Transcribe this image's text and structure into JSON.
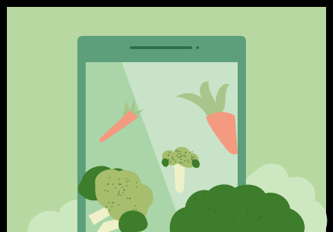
{
  "illustration": {
    "subject": "smartphone-with-vegetables",
    "colors": {
      "background": "#B7D9A1",
      "phone_body": "#5D9F7A",
      "phone_screen": "#C8E3C8",
      "screen_shade": "#A9D5A8",
      "cloud": "#CDE8C1",
      "carrot": "#F39A80",
      "carrot_leaves": "#A9C58B",
      "broccoli_light": "#A6BE6D",
      "broccoli_dark": "#3E7D2B",
      "stem": "#EEF1C8"
    },
    "icons": [
      "phone-icon",
      "carrot-icon",
      "broccoli-icon"
    ]
  }
}
